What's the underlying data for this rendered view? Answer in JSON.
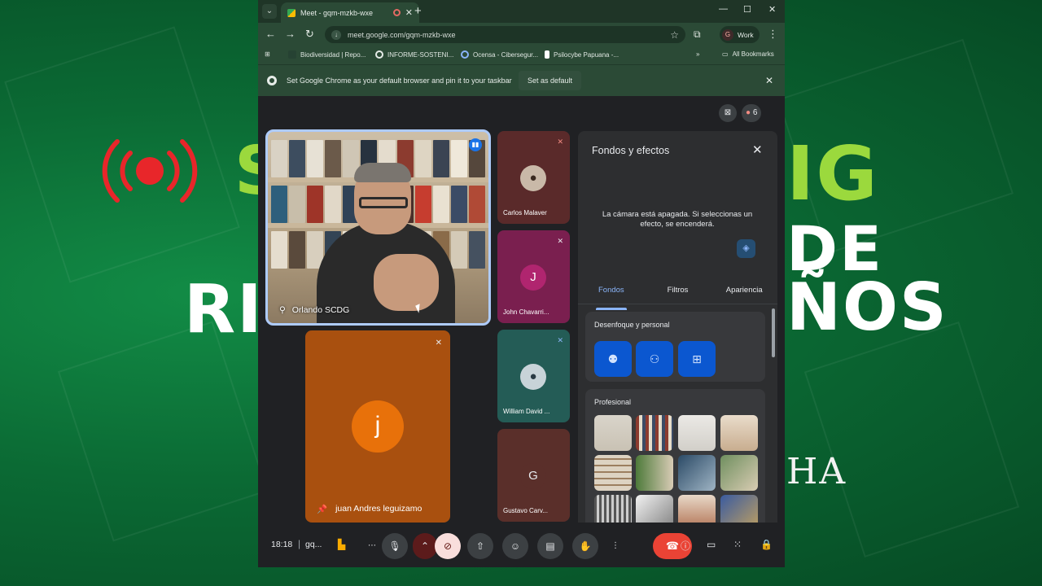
{
  "browser": {
    "tab_title": "Meet - gqm-mzkb-wxe",
    "url": "meet.google.com/gqm-mzkb-wxe",
    "profile_label": "Work",
    "profile_initial": "G",
    "bookmarks": [
      {
        "label": "Biodiversidad | Repo..."
      },
      {
        "label": "INFORME-SOSTENI..."
      },
      {
        "label": "Ocensa - Cibersegur..."
      },
      {
        "label": "Psilocybe Papuana -..."
      }
    ],
    "all_bookmarks_label": "All Bookmarks",
    "infobar_message": "Set Google Chrome as your default browser and pin it to your taskbar",
    "infobar_button": "Set as default"
  },
  "meet": {
    "participant_count": "6",
    "main_participant": {
      "name": "Orlando SCDG"
    },
    "side_participants": [
      {
        "name": "Carlos Malaver",
        "initial": "",
        "color": "#5a2a2a"
      },
      {
        "name": "John Chavarri...",
        "initial": "J",
        "color": "#7a1f4f"
      },
      {
        "name": "William David ...",
        "initial": "",
        "color": "#245c56"
      },
      {
        "name": "Gustavo Carv...",
        "initial": "G",
        "color": "#5a2f2a"
      }
    ],
    "pinned_participant": {
      "name": "juan Andres leguizamo",
      "initial": "j"
    },
    "time": "18:18",
    "meeting_code": "gq..."
  },
  "panel": {
    "title": "Fondos y efectos",
    "camera_off_message": "La cámara está apagada. Si seleccionas un efecto, se encenderá.",
    "tabs": [
      "Fondos",
      "Filtros",
      "Apariencia"
    ],
    "active_tab": "Fondos",
    "section_blur": "Desenfoque y personal",
    "section_professional": "Profesional"
  },
  "background": {
    "left_top_text": "S",
    "left_mid_text": "RI",
    "right_top_text": "IG",
    "right_mid_text": "DE",
    "right_bot_text": "ÑOS",
    "right_sig_text": "HA"
  },
  "colors": {
    "accent_blue": "#8ab4f8",
    "hangup_red": "#ea4335",
    "live_red": "#e8262a",
    "brand_green": "#9bd93d"
  }
}
